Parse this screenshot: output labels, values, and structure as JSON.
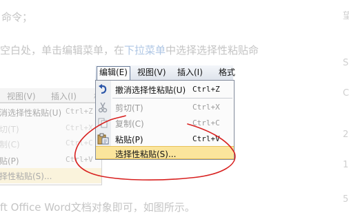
{
  "background_text": {
    "line1": "命令；",
    "line2_pre": "空白处，单击编辑菜单，在",
    "line2_link": "下拉菜单",
    "line2_post": "中选择选择性粘贴命",
    "line3": "ft Office Word文档对象即可，如图所示。",
    "right_glyphs": [
      "望",
      "S",
      "C",
      "2",
      "1",
      "5"
    ]
  },
  "ghost_menu": {
    "bar_items": [
      "视图(V)",
      "插入(I)",
      "格"
    ],
    "items": [
      {
        "label": "消选择性粘贴(U)",
        "shortcut": "Ctrl+Z",
        "disabled": false
      },
      {
        "label": "切(T)",
        "shortcut": "Ctrl+X",
        "disabled": true
      },
      {
        "label": "制(C)",
        "shortcut": "Ctrl+C",
        "disabled": true
      },
      {
        "label": "贴(P)",
        "shortcut": "Ctrl+V",
        "disabled": false
      },
      {
        "label": "择性粘贴(S)...",
        "shortcut": "",
        "disabled": false
      }
    ]
  },
  "menubar": {
    "items": [
      "编辑(E)",
      "视图(V)",
      "插入(I)",
      "格式"
    ]
  },
  "edit_menu": {
    "items": [
      {
        "label": "撤消选择性粘贴(U)",
        "shortcut": "Ctrl+Z",
        "icon": "undo-icon"
      },
      {
        "label": "剪切(T)",
        "shortcut": "Ctrl+X",
        "icon": "scissors-icon"
      },
      {
        "label": "复制(C)",
        "shortcut": "Ctrl+C",
        "icon": "copy-icon"
      },
      {
        "label": "粘贴(P)",
        "shortcut": "Ctrl+V",
        "icon": "paste-icon"
      },
      {
        "label": "选择性粘贴(S)...",
        "shortcut": "",
        "icon": ""
      }
    ]
  },
  "colors": {
    "annotation": "#d8201f",
    "highlight": "#fbe59c"
  }
}
